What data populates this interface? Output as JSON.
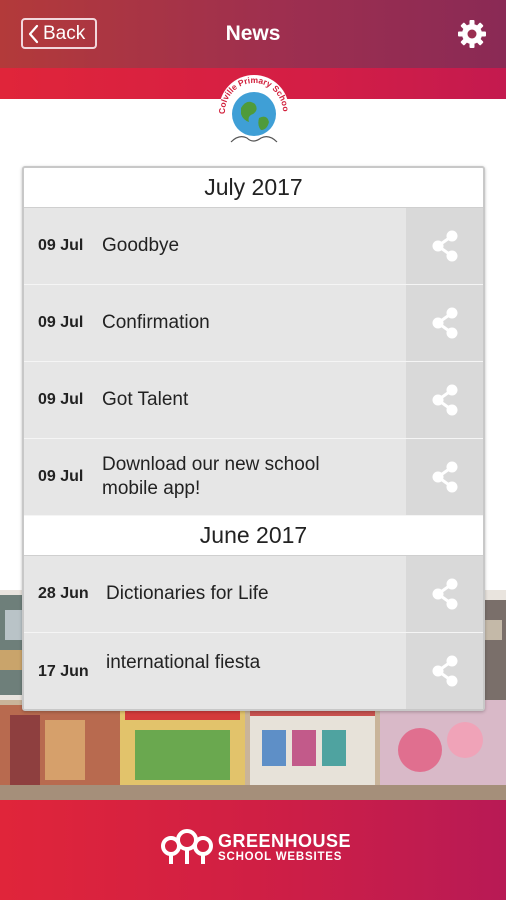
{
  "header": {
    "back_label": "Back",
    "title": "News",
    "back_icon": "chevron-left-icon",
    "settings_icon": "gear-icon"
  },
  "logo": {
    "name": "Colville Primary School",
    "text": "Colville Primary School"
  },
  "news": {
    "sections": [
      {
        "month": "July 2017",
        "items": [
          {
            "date": "09 Jul",
            "title": "Goodbye"
          },
          {
            "date": "09 Jul",
            "title": "Confirmation"
          },
          {
            "date": "09 Jul",
            "title": "Got Talent"
          },
          {
            "date": "09 Jul",
            "title": "Download our new school mobile app!"
          }
        ]
      },
      {
        "month": "June 2017",
        "items": [
          {
            "date": "28 Jun",
            "title": "Dictionaries for Life"
          },
          {
            "date": "17 Jun",
            "title": "international fiesta"
          }
        ]
      }
    ],
    "share_icon": "share-icon"
  },
  "footer": {
    "brand_main": "GREENHOUSE",
    "brand_sub": "SCHOOL WEBSITES"
  },
  "colors": {
    "header_bg": "#9e2f4f",
    "accent_red": "#e0253a",
    "panel_bg": "#e6e6e6"
  }
}
